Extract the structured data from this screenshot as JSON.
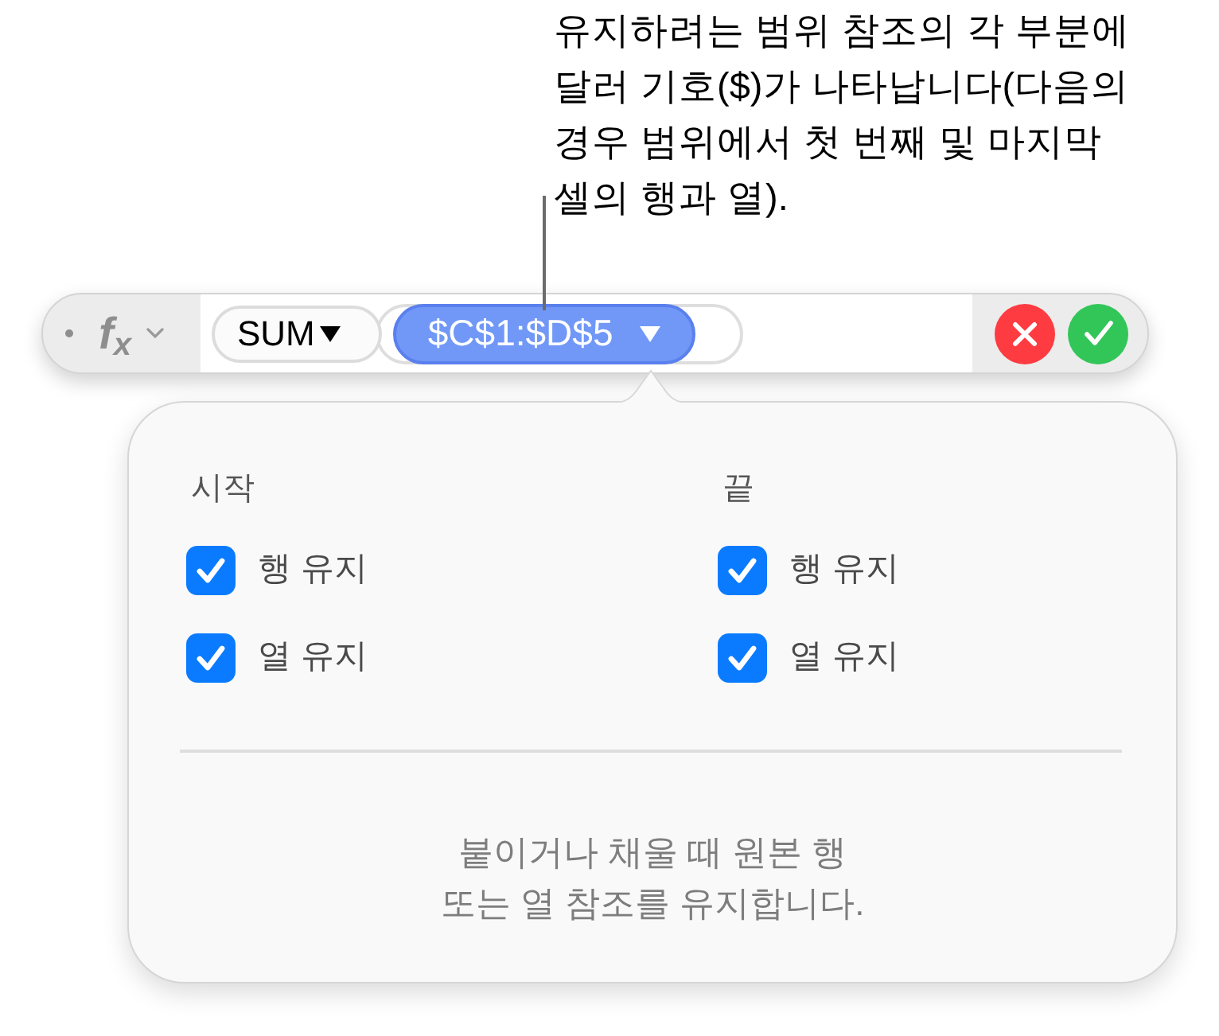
{
  "callout": {
    "lines": [
      "유지하려는 범위 참조의 각 부분에",
      "달러 기호($)가 나타납니다(다음의",
      "경우 범위에서 첫 번째 및 마지막",
      "셀의 행과 열)."
    ]
  },
  "formula_bar": {
    "function_symbol": "f$_{x}$",
    "tokens": [
      {
        "kind": "function",
        "label": "SUM"
      },
      {
        "kind": "range",
        "label": "$C$1:$D$5",
        "selected": true
      }
    ]
  },
  "popover": {
    "groups": [
      {
        "heading": "시작",
        "options": [
          {
            "label": "행 유지",
            "checked": true
          },
          {
            "label": "열 유지",
            "checked": true
          }
        ]
      },
      {
        "heading": "끝",
        "options": [
          {
            "label": "행 유지",
            "checked": true
          },
          {
            "label": "열 유지",
            "checked": true
          }
        ]
      }
    ],
    "note": [
      "붙이거나 채울 때 원본 행",
      "또는 열 참조를 유지합니다."
    ]
  }
}
